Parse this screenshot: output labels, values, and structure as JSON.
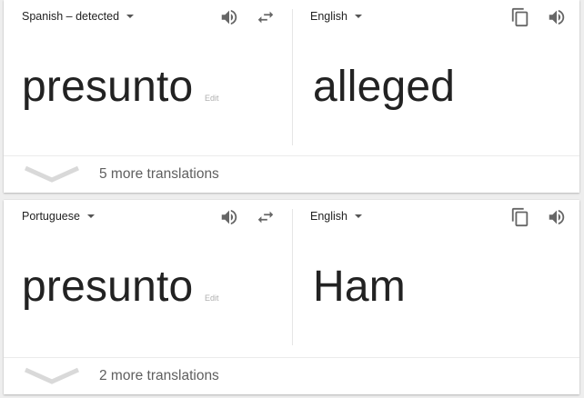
{
  "colors": {
    "icon": "#666666",
    "text_primary": "#222222",
    "text_secondary": "#5f5f5f",
    "edit_link": "#b0b0b0",
    "chevron": "#d9d9d9"
  },
  "icons": {
    "speaker": "speaker-icon",
    "swap": "swap-languages-icon",
    "copy": "copy-icon",
    "dropdown": "caret-down-icon",
    "expand": "chevron-down-icon"
  },
  "cards": [
    {
      "source": {
        "language": "Spanish – detected",
        "text": "presunto",
        "edit_label": "Edit"
      },
      "target": {
        "language": "English",
        "text": "alleged"
      },
      "more_translations": "5 more translations"
    },
    {
      "source": {
        "language": "Portuguese",
        "text": "presunto",
        "edit_label": "Edit"
      },
      "target": {
        "language": "English",
        "text": "Ham"
      },
      "more_translations": "2 more translations"
    }
  ]
}
